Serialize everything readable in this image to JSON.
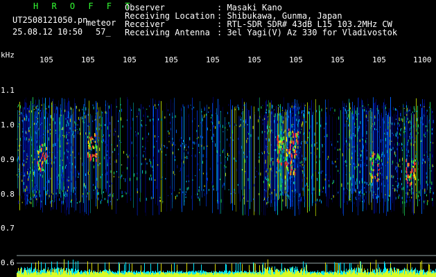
{
  "header": {
    "brand": "H R O F F T",
    "filename": "UT2508121050.pn",
    "mode": "meteor",
    "datetime": "25.08.12 10:50",
    "count": "57_",
    "fields": [
      {
        "label": "Observer",
        "value": ": Masaki Kano"
      },
      {
        "label": "Receiving Location",
        "value": ": Shibukawa, Gunma, Japan"
      },
      {
        "label": "Receiver",
        "value": ": RTL-SDR SDR# 43dB L15 103.2MHz CW"
      },
      {
        "label": "Receiving Antenna",
        "value": ": 3el Yagi(V) Az 330 for Vladivostok"
      }
    ]
  },
  "axis": {
    "unit": "kHz",
    "x_ticks": [
      "105",
      "105",
      "105",
      "105",
      "105",
      "105",
      "105",
      "105",
      "105",
      "1100"
    ],
    "y_ticks": [
      "1.1",
      "1.0",
      "0.9",
      "0.8",
      "0.7",
      "0.6"
    ]
  },
  "colors": {
    "background": "#000000",
    "brand": "#33ff33",
    "level_cyan": "#00e5ff",
    "level_yellow": "#ffff00"
  }
}
